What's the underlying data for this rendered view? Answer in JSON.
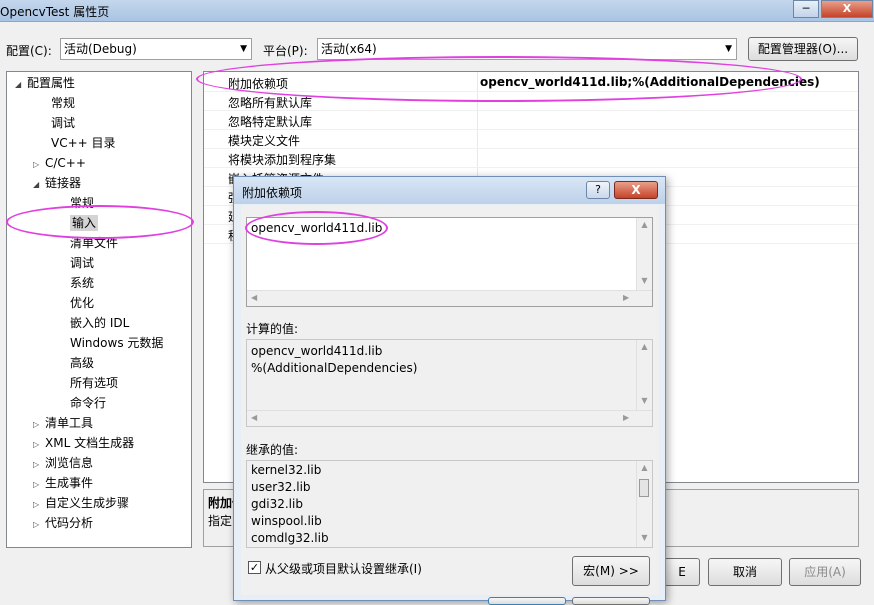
{
  "window": {
    "title": "OpencvTest 属性页",
    "minimize": "─",
    "close": "X"
  },
  "toolbar": {
    "config_label": "配置(C):",
    "config_value": "活动(Debug)",
    "platform_label": "平台(P):",
    "platform_value": "活动(x64)",
    "config_manager_button": "配置管理器(O)..."
  },
  "tree": {
    "items": [
      {
        "label": "配置属性",
        "toggle": "◢"
      },
      {
        "label": "常规"
      },
      {
        "label": "调试"
      },
      {
        "label": "VC++ 目录"
      },
      {
        "label": "C/C++",
        "toggle": "▷"
      },
      {
        "label": "链接器",
        "toggle": "◢"
      },
      {
        "label": "常规"
      },
      {
        "label": "输入"
      },
      {
        "label": "清单文件"
      },
      {
        "label": "调试"
      },
      {
        "label": "系统"
      },
      {
        "label": "优化"
      },
      {
        "label": "嵌入的 IDL"
      },
      {
        "label": "Windows 元数据"
      },
      {
        "label": "高级"
      },
      {
        "label": "所有选项"
      },
      {
        "label": "命令行"
      },
      {
        "label": "清单工具",
        "toggle": "▷"
      },
      {
        "label": "XML 文档生成器",
        "toggle": "▷"
      },
      {
        "label": "浏览信息",
        "toggle": "▷"
      },
      {
        "label": "生成事件",
        "toggle": "▷"
      },
      {
        "label": "自定义生成步骤",
        "toggle": "▷"
      },
      {
        "label": "代码分析",
        "toggle": "▷"
      }
    ]
  },
  "grid": {
    "rows": [
      {
        "name": "附加依赖项",
        "value": "opencv_world411d.lib;%(AdditionalDependencies)"
      },
      {
        "name": "忽略所有默认库",
        "value": ""
      },
      {
        "name": "忽略特定默认库",
        "value": ""
      },
      {
        "name": "模块定义文件",
        "value": ""
      },
      {
        "name": "将模块添加到程序集",
        "value": ""
      },
      {
        "name": "嵌入托管资源文件",
        "value": ""
      },
      {
        "name": "强",
        "value": ""
      },
      {
        "name": "延",
        "value": ""
      },
      {
        "name": "程",
        "value": ""
      }
    ]
  },
  "description": {
    "title": "附加依",
    "text": "指定"
  },
  "bottom_buttons": {
    "ok": "E",
    "cancel": "取消",
    "apply": "应用(A)"
  },
  "dialog": {
    "title": "附加依赖项",
    "help": "?",
    "close": "X",
    "edit_value": "opencv_world411d.lib",
    "computed_label": "计算的值:",
    "computed_values": [
      "opencv_world411d.lib",
      "%(AdditionalDependencies)"
    ],
    "inherited_label": "继承的值:",
    "inherited_values": [
      "kernel32.lib",
      "user32.lib",
      "gdi32.lib",
      "winspool.lib",
      "comdlg32.lib"
    ],
    "inherit_checkbox": "从父级或项目默认设置继承(I)",
    "inherit_checked": true,
    "macro_button": "宏(M) >>"
  },
  "colors": {
    "annotation": "#e040e0",
    "titlebar": "#a9c4e4"
  }
}
